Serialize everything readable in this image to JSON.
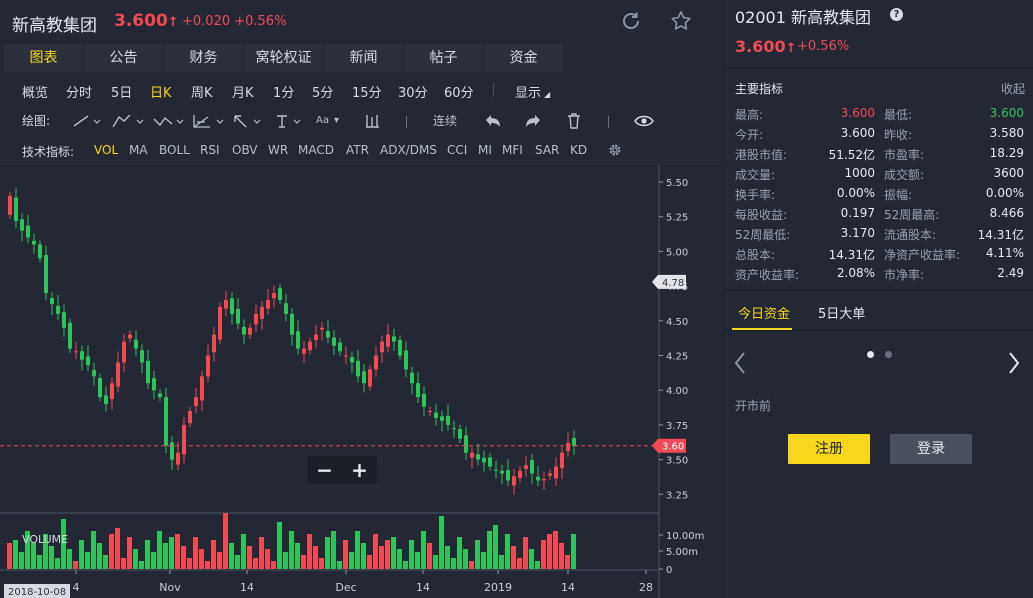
{
  "header": {
    "stock_name": "新高教集团",
    "price": "3.600",
    "price_arrow": "↑",
    "change": "+0.020 +0.56%"
  },
  "tabs": [
    "图表",
    "公告",
    "财务",
    "窝轮权证",
    "新闻",
    "帖子",
    "资金"
  ],
  "periods": [
    "概览",
    "分时",
    "5日",
    "日K",
    "周K",
    "月K",
    "1分",
    "5分",
    "15分",
    "30分",
    "60分"
  ],
  "display_label": "显示",
  "draw": {
    "label": "绘图:",
    "text_tool": "Aa",
    "continuous": "连续"
  },
  "indicators": {
    "label": "技术指标:",
    "items": [
      "VOL",
      "MA",
      "BOLL",
      "RSI",
      "OBV",
      "WR",
      "MACD",
      "ATR",
      "ADX/DMS",
      "CCI",
      "MI",
      "MFI",
      "SAR",
      "KD"
    ]
  },
  "colors": {
    "up": "#f04a54",
    "down": "#2ec45b",
    "accent": "#f6d71f"
  },
  "chart_data": {
    "type": "candlestick",
    "y_ticks": [
      "5.50",
      "5.25",
      "5.00",
      "4.75",
      "4.50",
      "4.25",
      "4.00",
      "3.75",
      "3.50",
      "3.25"
    ],
    "ylim": [
      3.13,
      5.55
    ],
    "x_ticks": [
      "4",
      "Nov",
      "14",
      "Dec",
      "14",
      "2019",
      "14",
      "28"
    ],
    "date_badge": "2018-10-08",
    "volume_label": "VOLUME",
    "volume_ticks": [
      "10.00m",
      "5.00m",
      "0"
    ],
    "high_marker": "4.78",
    "high_value": 4.78,
    "current_marker": "3.60",
    "current_value": 3.6,
    "zoom": {
      "minus": "−",
      "plus": "+"
    }
  },
  "right": {
    "title": "02001 新高教集团",
    "help": "?",
    "price": "3.600",
    "arrow": "↑",
    "change": "+0.56%",
    "metrics_title": "主要指标",
    "collapse": "收起",
    "metrics": [
      [
        "最高:",
        "3.600",
        "最低:",
        "3.600"
      ],
      [
        "今开:",
        "3.600",
        "昨收:",
        "3.580"
      ],
      [
        "港股市值:",
        "51.52亿",
        "市盈率:",
        "18.29"
      ],
      [
        "成交量:",
        "1000",
        "成交额:",
        "3600"
      ],
      [
        "换手率:",
        "0.00%",
        "振幅:",
        "0.00%"
      ],
      [
        "每股收益:",
        "0.197",
        "52周最高:",
        "8.466"
      ],
      [
        "52周最低:",
        "3.170",
        "流通股本:",
        "14.31亿"
      ],
      [
        "总股本:",
        "14.31亿",
        "净资产收益率:",
        "4.11%"
      ],
      [
        "资产收益率:",
        "2.08%",
        "市净率:",
        "2.49"
      ]
    ],
    "tabs": [
      "今日资金",
      "5日大单"
    ],
    "premarket": "开市前",
    "register": "注册",
    "login": "登录"
  }
}
